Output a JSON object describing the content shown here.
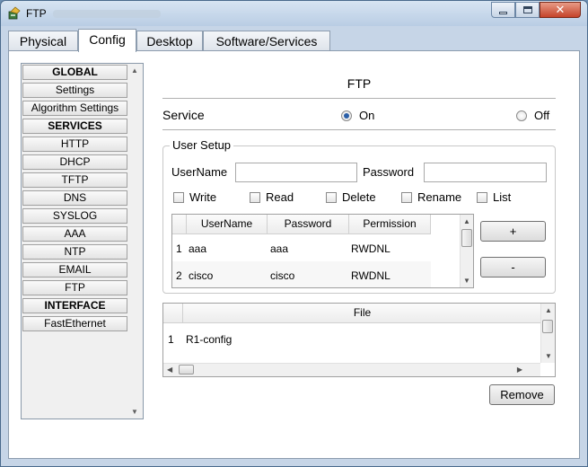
{
  "window": {
    "title": "FTP"
  },
  "tabs": [
    {
      "label": "Physical",
      "active": false
    },
    {
      "label": "Config",
      "active": true
    },
    {
      "label": "Desktop",
      "active": false
    },
    {
      "label": "Software/Services",
      "active": false
    }
  ],
  "sidebar": {
    "items": [
      {
        "label": "GLOBAL",
        "header": true
      },
      {
        "label": "Settings",
        "header": false
      },
      {
        "label": "Algorithm Settings",
        "header": false
      },
      {
        "label": "SERVICES",
        "header": true
      },
      {
        "label": "HTTP",
        "header": false
      },
      {
        "label": "DHCP",
        "header": false
      },
      {
        "label": "TFTP",
        "header": false
      },
      {
        "label": "DNS",
        "header": false
      },
      {
        "label": "SYSLOG",
        "header": false
      },
      {
        "label": "AAA",
        "header": false
      },
      {
        "label": "NTP",
        "header": false
      },
      {
        "label": "EMAIL",
        "header": false
      },
      {
        "label": "FTP",
        "header": false
      },
      {
        "label": "INTERFACE",
        "header": true
      },
      {
        "label": "FastEthernet",
        "header": false
      }
    ]
  },
  "ftp": {
    "title": "FTP",
    "service_label": "Service",
    "on_label": "On",
    "off_label": "Off",
    "service_state": "On",
    "user_setup": {
      "title": "User Setup",
      "username_label": "UserName",
      "username_value": "",
      "password_label": "Password",
      "password_value": "",
      "permissions": [
        {
          "label": "Write",
          "checked": false
        },
        {
          "label": "Read",
          "checked": false
        },
        {
          "label": "Delete",
          "checked": false
        },
        {
          "label": "Rename",
          "checked": false
        },
        {
          "label": "List",
          "checked": false
        }
      ],
      "table": {
        "headers": [
          "UserName",
          "Password",
          "Permission"
        ],
        "rows": [
          {
            "num": "1",
            "username": "aaa",
            "password": "aaa",
            "permission": "RWDNL"
          },
          {
            "num": "2",
            "username": "cisco",
            "password": "cisco",
            "permission": "RWDNL"
          }
        ]
      },
      "add_label": "+",
      "remove_label": "-"
    },
    "files": {
      "header": "File",
      "rows": [
        {
          "num": "1",
          "name": "R1-config"
        }
      ]
    },
    "remove_button_label": "Remove"
  },
  "colors": {
    "title_bar": "#c6d5e7",
    "close_button": "#c4432a",
    "radio_selected": "#2a5fa8"
  },
  "icons": [
    "app-icon",
    "minimize-icon",
    "maximize-icon",
    "close-icon",
    "scroll-up-icon",
    "scroll-down-icon",
    "scroll-left-icon",
    "scroll-right-icon"
  ]
}
